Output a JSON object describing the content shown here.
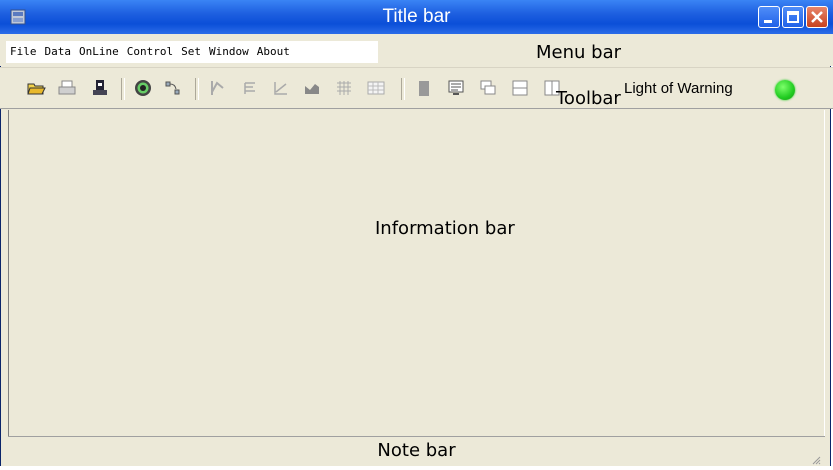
{
  "title_bar": {
    "title": "Title bar"
  },
  "menu_bar": {
    "items": [
      {
        "label": "File"
      },
      {
        "label": "Data"
      },
      {
        "label": "OnLine"
      },
      {
        "label": "Control"
      },
      {
        "label": "Set"
      },
      {
        "label": "Window"
      },
      {
        "label": "About"
      }
    ],
    "caption": "Menu bar"
  },
  "toolbar": {
    "caption": "Toolbar",
    "warning_label": "Light of Warning",
    "warning_color": "#22cc22",
    "buttons": [
      "open-folder-icon",
      "print-icon",
      "save-icon",
      "connect-icon",
      "transfer-icon",
      "chart-icon",
      "list-icon",
      "curve-icon",
      "bar-chart-icon",
      "grid-icon",
      "table-icon",
      "block-icon",
      "monitor-icon",
      "cascade-icon",
      "tile-icon",
      "window-icon"
    ]
  },
  "information_bar": {
    "caption": "Information bar"
  },
  "note_bar": {
    "caption": "Note bar"
  }
}
